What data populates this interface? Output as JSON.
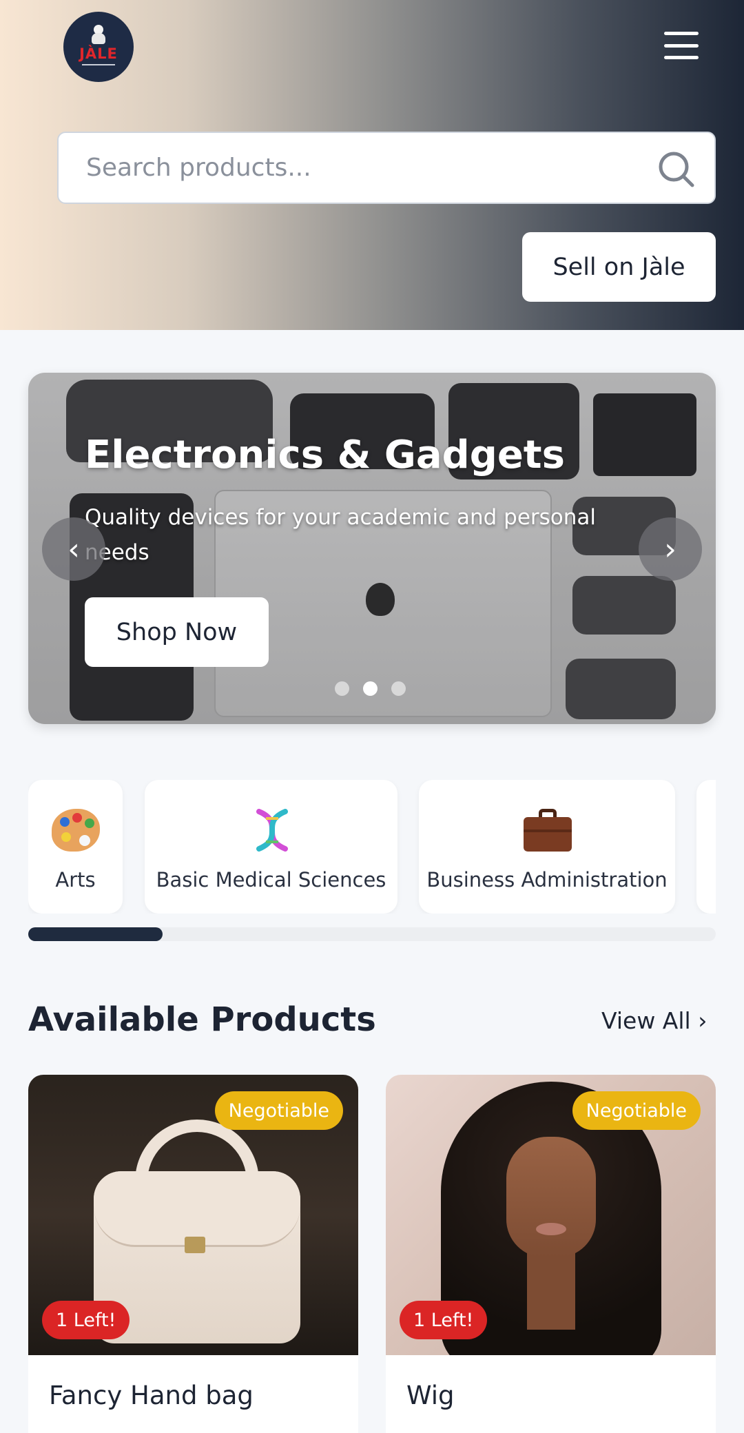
{
  "header": {
    "logo_text": "JÀLE",
    "search_placeholder": "Search products...",
    "sell_button": "Sell on Jàle"
  },
  "hero": {
    "title": "Electronics & Gadgets",
    "subtitle": "Quality devices for your academic and personal needs",
    "cta": "Shop Now",
    "slide_count": 3,
    "active_slide": 2
  },
  "categories": [
    {
      "label": "Arts",
      "icon": "artist-palette-icon"
    },
    {
      "label": "Basic Medical Sciences",
      "icon": "dna-icon"
    },
    {
      "label": "Business Administration",
      "icon": "briefcase-icon"
    }
  ],
  "category_scroll_position": 0.19,
  "products_section": {
    "title": "Available Products",
    "view_all": "View All"
  },
  "products": [
    {
      "name": "Fancy Hand bag",
      "badge_price": "Negotiable",
      "stock": "1 Left!"
    },
    {
      "name": "Wig",
      "badge_price": "Negotiable",
      "stock": "1 Left!"
    }
  ],
  "colors": {
    "navy": "#1d2636",
    "negotiable_badge": "#eab512",
    "stock_badge": "#db2525"
  }
}
